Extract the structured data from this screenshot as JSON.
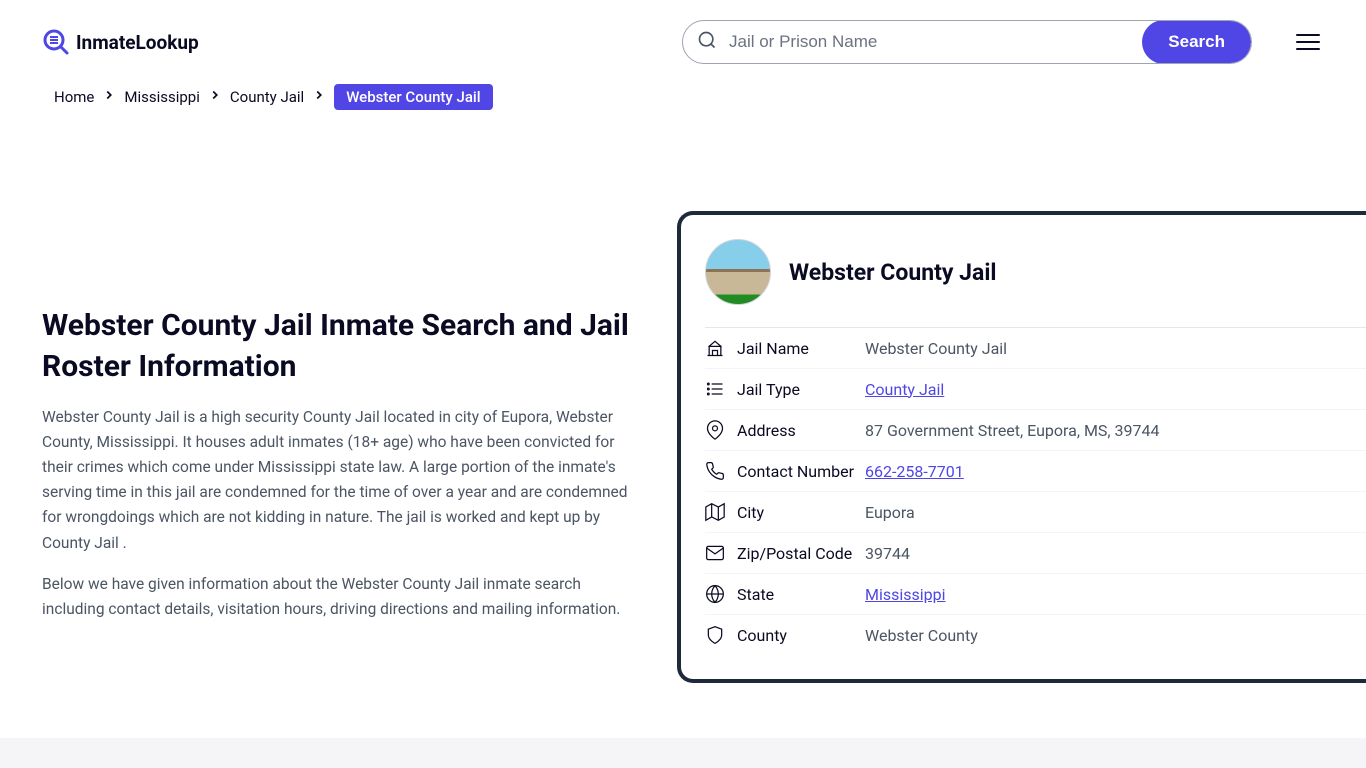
{
  "logo": {
    "text": "InmateLookup"
  },
  "search": {
    "placeholder": "Jail or Prison Name",
    "button": "Search"
  },
  "breadcrumb": {
    "items": [
      {
        "label": "Home"
      },
      {
        "label": "Mississippi"
      },
      {
        "label": "County Jail"
      }
    ],
    "current": "Webster County Jail"
  },
  "main": {
    "title": "Webster County Jail Inmate Search and Jail Roster Information",
    "para1": "Webster County Jail is a high security County Jail located in city of Eupora, Webster County, Mississippi. It houses adult inmates (18+ age) who have been convicted for their crimes which come under Mississippi state law. A large portion of the inmate's serving time in this jail are condemned for the time of over a year and are condemned for wrongdoings which are not kidding in nature. The jail is worked and kept up by County Jail .",
    "para2": "Below we have given information about the Webster County Jail inmate search including contact details, visitation hours, driving directions and mailing information."
  },
  "card": {
    "title": "Webster County Jail",
    "rows": [
      {
        "label": "Jail Name",
        "value": "Webster County Jail",
        "link": false
      },
      {
        "label": "Jail Type",
        "value": "County Jail",
        "link": true
      },
      {
        "label": "Address",
        "value": "87 Government Street, Eupora, MS, 39744",
        "link": false
      },
      {
        "label": "Contact Number",
        "value": "662-258-7701",
        "link": true
      },
      {
        "label": "City",
        "value": "Eupora",
        "link": false
      },
      {
        "label": "Zip/Postal Code",
        "value": "39744",
        "link": false
      },
      {
        "label": "State",
        "value": "Mississippi",
        "link": true
      },
      {
        "label": "County",
        "value": "Webster County",
        "link": false
      }
    ]
  }
}
